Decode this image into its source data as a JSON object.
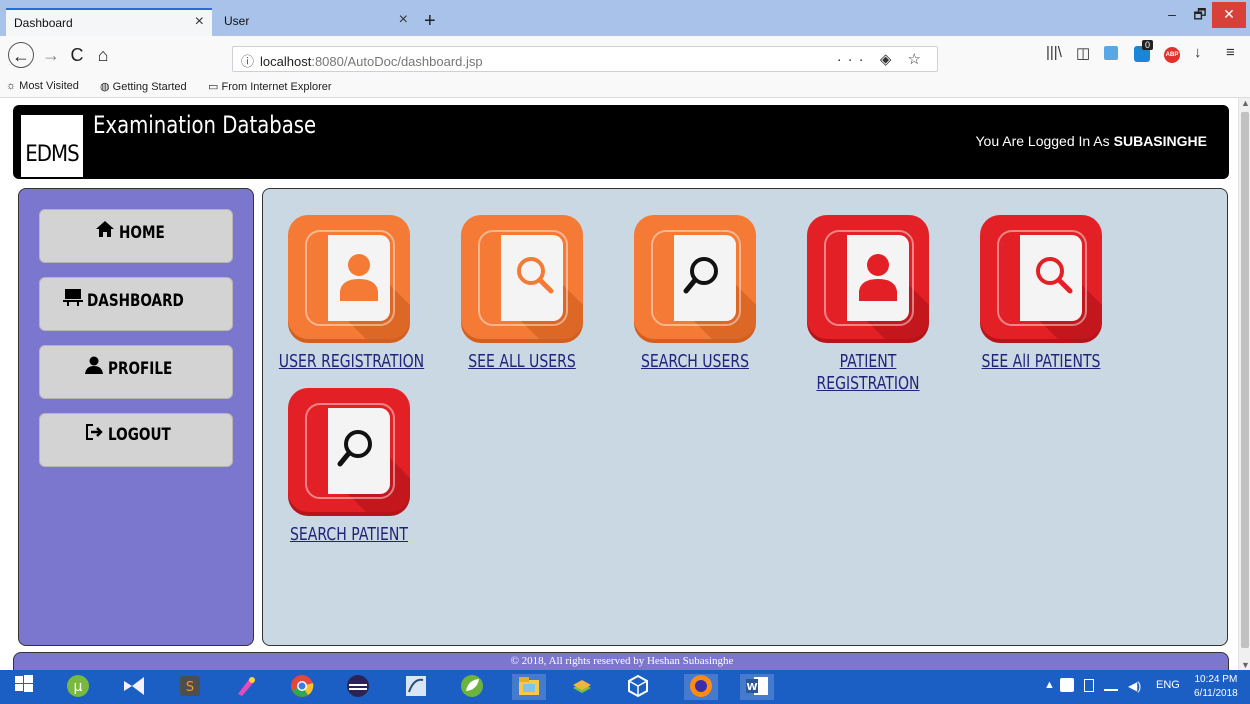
{
  "browser": {
    "tabs": [
      {
        "label": "Dashboard",
        "active": true
      },
      {
        "label": "User",
        "active": false
      }
    ],
    "new_tab": "+",
    "close_glyph": "×",
    "window_controls": {
      "minimize": "–",
      "maximize": "🗗",
      "close": "✕"
    },
    "nav": {
      "back": "←",
      "forward": "→",
      "reload": "C",
      "home": "⌂"
    },
    "url": {
      "info_icon": "ⓘ",
      "host": "localhost",
      "port_path": ":8080/AutoDoc/dashboard.jsp",
      "actions": "··· ◈ ☆"
    },
    "toolbar_icons": [
      "library-icon",
      "sidebar-icon",
      "pocket-icon",
      "extension-icon",
      "abp-icon",
      "download-icon",
      "menu-icon"
    ],
    "toolbar_glyphs": {
      "library": "|||\\",
      "sidebar": "◫",
      "download": "↓",
      "menu": "≡",
      "abp": "ABP",
      "badge": "0"
    },
    "bookmarks": [
      {
        "label": "Most Visited",
        "icon": "☼"
      },
      {
        "label": "Getting Started",
        "icon": "◍"
      },
      {
        "label": "From Internet Explorer",
        "icon": "▭"
      }
    ]
  },
  "header": {
    "logo": "EDMS",
    "title": "Examination Database",
    "login_prefix": "You Are Logged In As",
    "username": "SUBASINGHE"
  },
  "sidebar": {
    "items": [
      {
        "label": "HOME",
        "icon": "home-icon",
        "glyph": "🏠"
      },
      {
        "label": "DASHBOARD",
        "icon": "dashboard-icon",
        "glyph": "▀"
      },
      {
        "label": "PROFILE",
        "icon": "user-icon",
        "glyph": "👤"
      },
      {
        "label": "LOGOUT",
        "icon": "logout-icon",
        "glyph": "⇨"
      }
    ]
  },
  "tiles": [
    {
      "label": "USER REGISTRATION",
      "color": "orange",
      "glyph": "person"
    },
    {
      "label": "SEE ALL USERS",
      "color": "orange",
      "glyph": "search"
    },
    {
      "label": "SEARCH USERS",
      "color": "orange",
      "glyph": "search-dark"
    },
    {
      "label": "PATIENT REGISTRATION",
      "color": "red",
      "glyph": "person"
    },
    {
      "label": "SEE AlI PATIENTS",
      "color": "red",
      "glyph": "search"
    },
    {
      "label": "SEARCH PATIENT",
      "color": "red",
      "glyph": "search-dark"
    }
  ],
  "colors": {
    "orange": "#f47a35",
    "orange_dark": "#d35f1f",
    "red": "#e32025",
    "red_dark": "#b5141a",
    "sidebar_bg": "#7b77cf",
    "content_bg": "#cad8e3",
    "link": "#22237a"
  },
  "footer": {
    "text": "© 2018, All rights reserved by Heshan Subasinghe"
  },
  "taskbar": {
    "apps": [
      "windows-start-icon",
      "utorrent-icon",
      "visual-studio-icon",
      "sublime-icon",
      "paint-icon",
      "chrome-icon",
      "eclipse-icon",
      "mysql-workbench-icon",
      "spring-icon",
      "file-explorer-icon",
      "bluestacks-icon",
      "virtualbox-icon",
      "firefox-icon",
      "word-icon"
    ],
    "tray": {
      "lang": "ENG",
      "caret": "▲"
    },
    "clock_time": "10:24 PM",
    "clock_date": "6/11/2018"
  }
}
